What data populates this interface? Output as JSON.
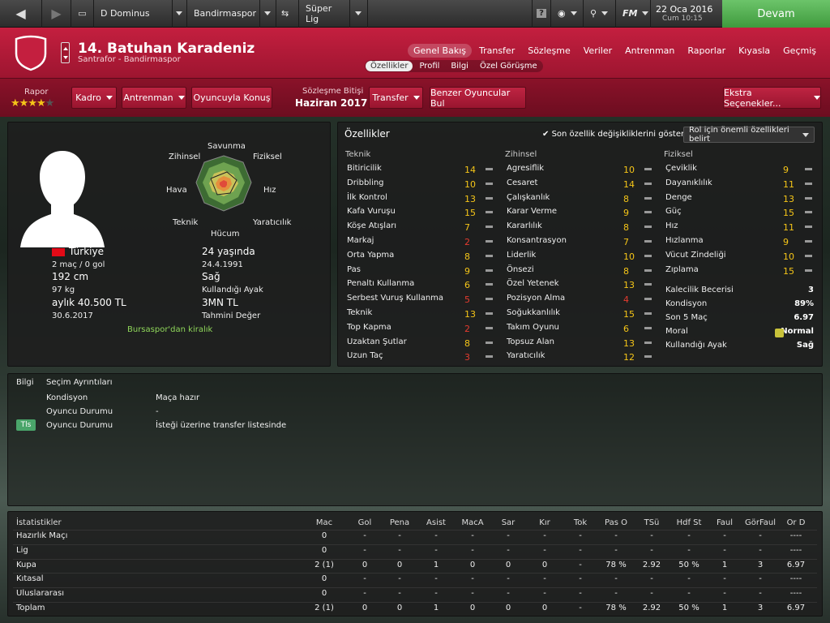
{
  "topbar": {
    "manager": "D Dominus",
    "club": "Bandirmaspor",
    "competition": "Süper Lig",
    "fm_label": "FM",
    "date": "22 Oca 2016",
    "time": "Cum 10:15",
    "continue_label": "Devam"
  },
  "player": {
    "name": "14. Batuhan Karadeniz",
    "role": "Santrafor - Bandirmaspor"
  },
  "nav": {
    "tabs": [
      "Genel Bakış",
      "Transfer",
      "Sözleşme",
      "Veriler",
      "Antrenman",
      "Raporlar",
      "Kıyasla",
      "Geçmiş"
    ],
    "subtabs": [
      "Özellikler",
      "Profil",
      "Bilgi",
      "Özel Görüşme"
    ]
  },
  "actions": {
    "report_label": "Rapor",
    "stars": 4,
    "squad": "Kadro",
    "training": "Antrenman",
    "talk": "Oyuncuyla Konuş",
    "contract_label": "Sözleşme Bitişi",
    "contract_date": "Haziran 2017",
    "transfer": "Transfer",
    "similar": "Benzer Oyuncular Bul",
    "extra": "Ekstra Seçenekler..."
  },
  "profile": {
    "nation": "Türkiye",
    "apps": "2 maç / 0 gol",
    "height": "192 cm",
    "weight": "97 kg",
    "wage": "aylık 40.500 TL",
    "contract_end": "30.6.2017",
    "age": "24 yaşında",
    "dob": "24.4.1991",
    "foot": "Sağ",
    "foot_label": "Kullandığı Ayak",
    "value": "3MN TL",
    "value_label": "Tahmini Değer",
    "loan": "Bursaspor'dan kiralık"
  },
  "radar": {
    "labels": [
      "Savunma",
      "Fiziksel",
      "Hız",
      "Yaratıcılık",
      "Hücum",
      "Teknik",
      "Hava",
      "Zihinsel"
    ]
  },
  "attributes": {
    "title": "Özellikler",
    "show_changes": "Son özellik değişikliklerini göster",
    "role_dropdown": "Rol için önemli özellikleri belirt",
    "technical_title": "Teknik",
    "mental_title": "Zihinsel",
    "physical_title": "Fiziksel",
    "technical": [
      {
        "name": "Bitiricilik",
        "value": "14",
        "color": "y"
      },
      {
        "name": "Dribbling",
        "value": "10",
        "color": "y"
      },
      {
        "name": "İlk Kontrol",
        "value": "13",
        "color": "y"
      },
      {
        "name": "Kafa Vuruşu",
        "value": "15",
        "color": "y"
      },
      {
        "name": "Köşe Atışları",
        "value": "7",
        "color": "y"
      },
      {
        "name": "Markaj",
        "value": "2",
        "color": "r"
      },
      {
        "name": "Orta Yapma",
        "value": "8",
        "color": "y"
      },
      {
        "name": "Pas",
        "value": "9",
        "color": "y"
      },
      {
        "name": "Penaltı Kullanma",
        "value": "6",
        "color": "y"
      },
      {
        "name": "Serbest Vuruş Kullanma",
        "value": "5",
        "color": "r"
      },
      {
        "name": "Teknik",
        "value": "13",
        "color": "y"
      },
      {
        "name": "Top Kapma",
        "value": "2",
        "color": "r"
      },
      {
        "name": "Uzaktan Şutlar",
        "value": "8",
        "color": "y"
      },
      {
        "name": "Uzun Taç",
        "value": "3",
        "color": "r"
      }
    ],
    "mental": [
      {
        "name": "Agresiflik",
        "value": "10",
        "color": "y"
      },
      {
        "name": "Cesaret",
        "value": "14",
        "color": "y"
      },
      {
        "name": "Çalışkanlık",
        "value": "8",
        "color": "y"
      },
      {
        "name": "Karar Verme",
        "value": "9",
        "color": "y"
      },
      {
        "name": "Kararlılık",
        "value": "8",
        "color": "y"
      },
      {
        "name": "Konsantrasyon",
        "value": "7",
        "color": "y"
      },
      {
        "name": "Liderlik",
        "value": "10",
        "color": "y"
      },
      {
        "name": "Önsezi",
        "value": "8",
        "color": "y"
      },
      {
        "name": "Özel Yetenek",
        "value": "13",
        "color": "y"
      },
      {
        "name": "Pozisyon Alma",
        "value": "4",
        "color": "r"
      },
      {
        "name": "Soğukkanlılık",
        "value": "15",
        "color": "y"
      },
      {
        "name": "Takım Oyunu",
        "value": "6",
        "color": "y"
      },
      {
        "name": "Topsuz Alan",
        "value": "13",
        "color": "y"
      },
      {
        "name": "Yaratıcılık",
        "value": "12",
        "color": "y"
      }
    ],
    "physical": [
      {
        "name": "Çeviklik",
        "value": "9",
        "color": "y"
      },
      {
        "name": "Dayanıklılık",
        "value": "11",
        "color": "y"
      },
      {
        "name": "Denge",
        "value": "13",
        "color": "y"
      },
      {
        "name": "Güç",
        "value": "15",
        "color": "y"
      },
      {
        "name": "Hız",
        "value": "11",
        "color": "y"
      },
      {
        "name": "Hızlanma",
        "value": "9",
        "color": "y"
      },
      {
        "name": "Vücut Zindeliği",
        "value": "10",
        "color": "y"
      },
      {
        "name": "Zıplama",
        "value": "15",
        "color": "y"
      }
    ],
    "extra": [
      {
        "name": "Kalecilik Becerisi",
        "value": "3"
      },
      {
        "name": "Kondisyon",
        "value": "89%"
      },
      {
        "name": "Son 5 Maç",
        "value": "6.97"
      },
      {
        "name": "Moral",
        "value": "Normal"
      },
      {
        "name": "Kullandığı Ayak",
        "value": "Sağ"
      }
    ]
  },
  "info": {
    "tab1": "Bilgi",
    "tab2": "Seçim Ayrıntıları",
    "rows": [
      {
        "badge": "",
        "label": "Kondisyon",
        "value": "Maça hazır"
      },
      {
        "badge": "",
        "label": "Oyuncu Durumu",
        "value": "-"
      },
      {
        "badge": "Tls",
        "label": "Oyuncu Durumu",
        "value": "İsteği üzerine transfer listesinde"
      }
    ]
  },
  "stats": {
    "title": "İstatistikler",
    "headers": [
      "Mac",
      "Gol",
      "Pena",
      "Asist",
      "MacA",
      "Sar",
      "Kır",
      "Tok",
      "Pas O",
      "TSü",
      "Hdf St",
      "Faul",
      "GörFaul",
      "Or D"
    ],
    "rows": [
      {
        "name": "Hazırlık Maçı",
        "cells": [
          "0",
          "-",
          "-",
          "-",
          "-",
          "-",
          "-",
          "-",
          "-",
          "-",
          "-",
          "-",
          "-",
          "----"
        ]
      },
      {
        "name": "Lig",
        "cells": [
          "0",
          "-",
          "-",
          "-",
          "-",
          "-",
          "-",
          "-",
          "-",
          "-",
          "-",
          "-",
          "-",
          "----"
        ]
      },
      {
        "name": "Kupa",
        "cells": [
          "2 (1)",
          "0",
          "0",
          "1",
          "0",
          "0",
          "0",
          "-",
          "78 %",
          "2.92",
          "50 %",
          "1",
          "3",
          "6.97"
        ]
      },
      {
        "name": "Kıtasal",
        "cells": [
          "0",
          "-",
          "-",
          "-",
          "-",
          "-",
          "-",
          "-",
          "-",
          "-",
          "-",
          "-",
          "-",
          "----"
        ]
      },
      {
        "name": "Uluslararası",
        "cells": [
          "0",
          "-",
          "-",
          "-",
          "-",
          "-",
          "-",
          "-",
          "-",
          "-",
          "-",
          "-",
          "-",
          "----"
        ]
      },
      {
        "name": "Toplam",
        "cells": [
          "2 (1)",
          "0",
          "0",
          "1",
          "0",
          "0",
          "0",
          "-",
          "78 %",
          "2.92",
          "50 %",
          "1",
          "3",
          "6.97"
        ]
      }
    ]
  }
}
